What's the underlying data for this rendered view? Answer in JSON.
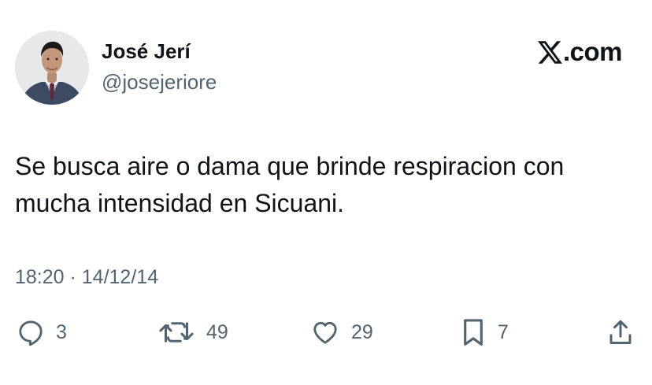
{
  "author": {
    "display_name": "José Jerí",
    "handle": "@josejeriore",
    "avatar_icon": "profile-photo"
  },
  "brand": {
    "logo_icon": "x-logo-icon",
    "text": ".com"
  },
  "tweet": {
    "text": "Se busca aire o dama que brinde respiracion con mucha intensidad en Sicuani.",
    "timestamp": "18:20 · 14/12/14"
  },
  "actions": {
    "reply": {
      "icon": "reply-icon",
      "count": "3"
    },
    "retweet": {
      "icon": "retweet-icon",
      "count": "49"
    },
    "like": {
      "icon": "heart-icon",
      "count": "29"
    },
    "bookmark": {
      "icon": "bookmark-icon",
      "count": "7"
    },
    "share": {
      "icon": "share-icon"
    }
  },
  "colors": {
    "text_primary": "#0f1419",
    "text_secondary": "#536471",
    "background": "#ffffff"
  }
}
